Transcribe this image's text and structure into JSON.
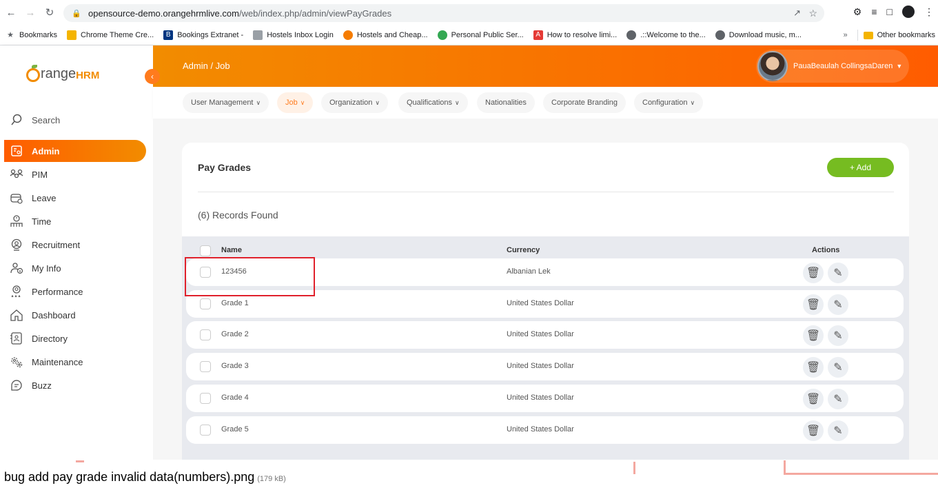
{
  "browser": {
    "url_host": "opensource-demo.orangehrmlive.com",
    "url_path": "/web/index.php/admin/viewPayGrades",
    "bookmarks": [
      {
        "label": "Bookmarks",
        "icon": "star-icon"
      },
      {
        "label": "Chrome Theme Cre...",
        "icon": "theme-icon"
      },
      {
        "label": "Bookings Extranet -",
        "icon": "booking-icon"
      },
      {
        "label": "Hostels Inbox Login",
        "icon": "hostels-icon"
      },
      {
        "label": "Hostels and Cheap...",
        "icon": "hostelworld-icon"
      },
      {
        "label": "Personal Public Ser...",
        "icon": "gov-icon"
      },
      {
        "label": "How to resolve limi...",
        "icon": "adobe-icon"
      },
      {
        "label": ".::Welcome to the...",
        "icon": "globe-icon"
      },
      {
        "label": "Download music, m...",
        "icon": "globe-icon"
      }
    ],
    "other_bookmarks": "Other bookmarks",
    "more_chevron": "»"
  },
  "app": {
    "logo_main": "range",
    "logo_hrm": "HRM",
    "breadcrumb": "Admin / Job",
    "user_name": "PauaBeaulah CollingsaDaren"
  },
  "sidebar": {
    "items": [
      {
        "label": "Search",
        "icon": "search-icon"
      },
      {
        "label": "Admin",
        "icon": "admin-icon"
      },
      {
        "label": "PIM",
        "icon": "pim-icon"
      },
      {
        "label": "Leave",
        "icon": "leave-icon"
      },
      {
        "label": "Time",
        "icon": "time-icon"
      },
      {
        "label": "Recruitment",
        "icon": "recruitment-icon"
      },
      {
        "label": "My Info",
        "icon": "myinfo-icon"
      },
      {
        "label": "Performance",
        "icon": "performance-icon"
      },
      {
        "label": "Dashboard",
        "icon": "dashboard-icon"
      },
      {
        "label": "Directory",
        "icon": "directory-icon"
      },
      {
        "label": "Maintenance",
        "icon": "maintenance-icon"
      },
      {
        "label": "Buzz",
        "icon": "buzz-icon"
      }
    ]
  },
  "subnav": {
    "tabs": [
      {
        "label": "User Management",
        "dropdown": true
      },
      {
        "label": "Job",
        "dropdown": true
      },
      {
        "label": "Organization",
        "dropdown": true
      },
      {
        "label": "Qualifications",
        "dropdown": true
      },
      {
        "label": "Nationalities",
        "dropdown": false
      },
      {
        "label": "Corporate Branding",
        "dropdown": false
      },
      {
        "label": "Configuration",
        "dropdown": true
      }
    ]
  },
  "page": {
    "title": "Pay Grades",
    "add_label": "+ Add",
    "records_found": "(6) Records Found",
    "columns": {
      "name": "Name",
      "currency": "Currency",
      "actions": "Actions"
    },
    "rows": [
      {
        "name": "123456",
        "currency": "Albanian Lek"
      },
      {
        "name": "Grade 1",
        "currency": "United States Dollar"
      },
      {
        "name": "Grade 2",
        "currency": "United States Dollar"
      },
      {
        "name": "Grade 3",
        "currency": "United States Dollar"
      },
      {
        "name": "Grade 4",
        "currency": "United States Dollar"
      },
      {
        "name": "Grade 5",
        "currency": "United States Dollar"
      }
    ]
  },
  "attachment": {
    "filename": "bug add pay grade invalid data(numbers).png",
    "size": "(179 kB)"
  },
  "colors": {
    "brand_orange": "#ff7b1d",
    "add_green": "#76bc21",
    "highlight_red": "#e0202b"
  }
}
